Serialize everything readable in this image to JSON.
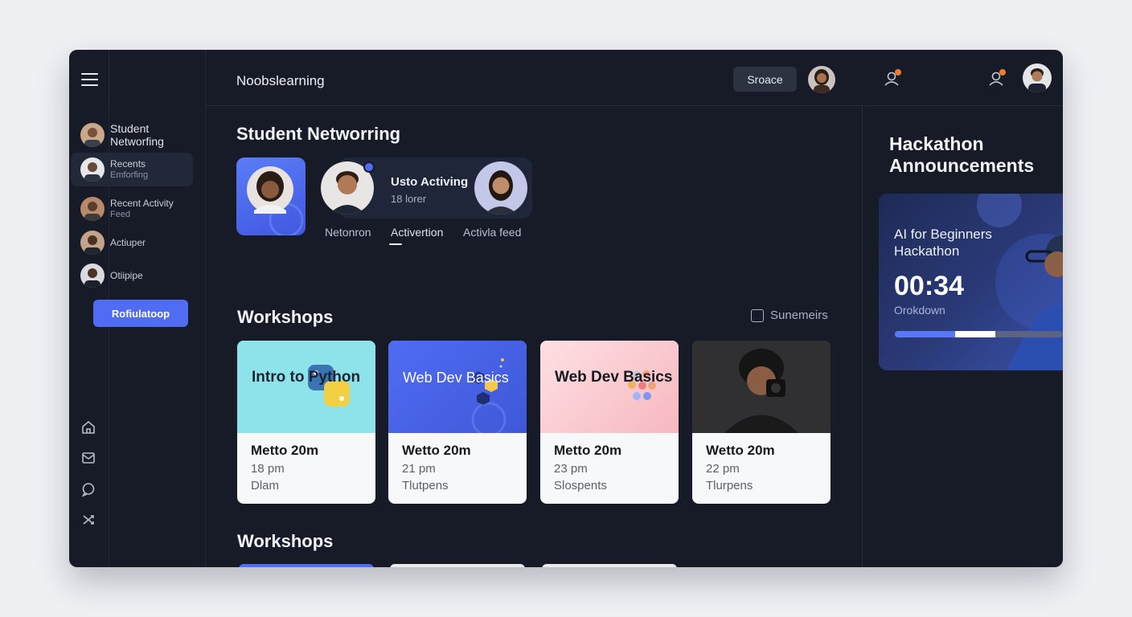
{
  "app": {
    "brand": "Noobslearning"
  },
  "header": {
    "button_label": "Sroace"
  },
  "sidebar": {
    "items": [
      {
        "label": "Student",
        "sub": "Networfing"
      },
      {
        "label": "Recents",
        "sub": "Emforfing"
      },
      {
        "label": "Recent Activity",
        "sub": "Feed"
      },
      {
        "label": "Actiuper",
        "sub": ""
      },
      {
        "label": "Otiipipe",
        "sub": ""
      }
    ],
    "button_label": "Rofiulatoop",
    "icons": [
      "home-icon",
      "mail-icon",
      "chat-icon",
      "shuffle-icon"
    ]
  },
  "networking": {
    "title": "Student Networring",
    "pill_title": "Usto Activing",
    "pill_sub": "18 lorer",
    "tabs": [
      "Netonron",
      "Activertion",
      "Activla feed"
    ]
  },
  "workshops": {
    "title": "Workshops",
    "see_more": "Sunemeirs",
    "cards": [
      {
        "thumb_title": "Intro to Python",
        "t1": "Metto 20m",
        "t2": "18 pm",
        "t3": "Dlam",
        "theme": "#8ee3ea"
      },
      {
        "thumb_title": "Web Dev Basics",
        "t1": "Wetto 20m",
        "t2": "21 pm",
        "t3": "Tlutpens",
        "theme": "#4f6cf2"
      },
      {
        "thumb_title": "Web Dev Basics",
        "t1": "Metto 20m",
        "t2": "23 pm",
        "t3": "Slospents",
        "theme": "#f7c3c9"
      },
      {
        "thumb_title": "",
        "t1": "Wetto 20m",
        "t2": "22 pm",
        "t3": "Tlurpens",
        "theme": "#2a2a2c"
      }
    ],
    "second_title": "Workshops"
  },
  "hackathon": {
    "title": "Hackathon Announcements",
    "event": "AI for Beginners Hackathon",
    "time": "00:34",
    "sub": "Orokdown",
    "progress": 0.6
  },
  "colors": {
    "accent": "#4f6cf2",
    "notification": "#f27a2e",
    "background": "#171b27"
  }
}
